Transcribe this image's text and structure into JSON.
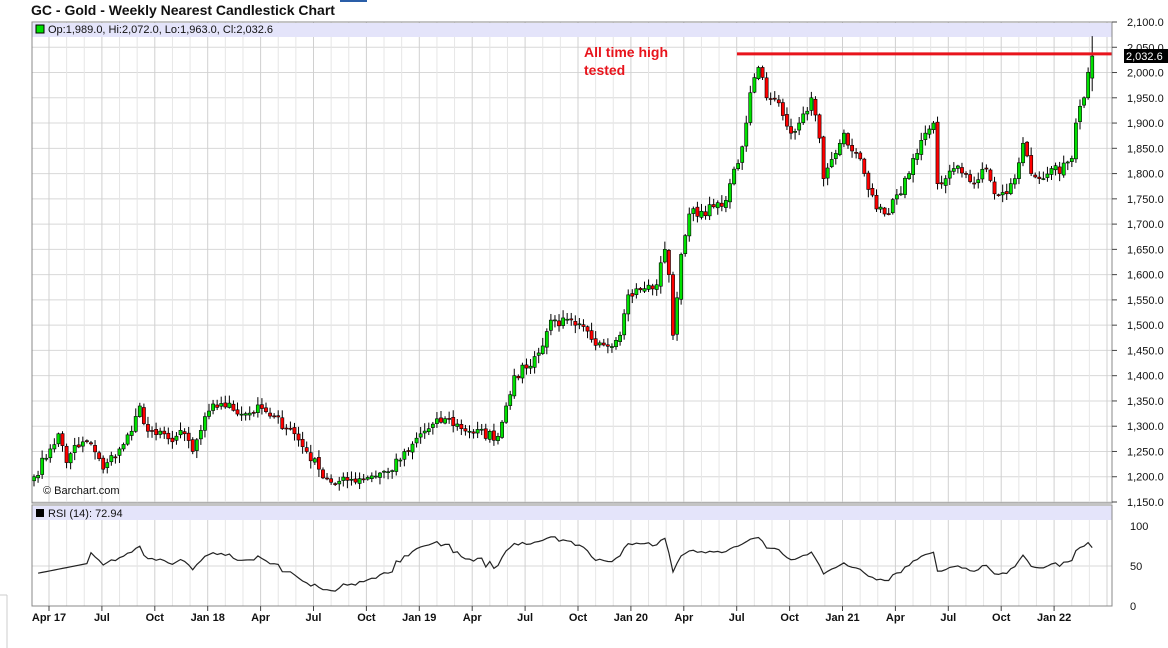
{
  "title": "GC - Gold - Weekly Nearest Candlestick Chart",
  "ohlc_label": "Op:1,989.0, Hi:2,072.0, Lo:1,963.0, Cl:2,032.6",
  "last_price_label": "2,032.6",
  "watermark": "© Barchart.com",
  "rsi_label": "RSI (14): 72.94",
  "annotation": [
    "All time high",
    "tested"
  ],
  "colors": {
    "up": "#00e000",
    "down": "#ff0000",
    "resistance": "#e8141c",
    "band": "#e4e4fa",
    "grid": "#d8d8d8"
  },
  "chart_data": {
    "type": "candlestick",
    "title": "GC - Gold - Weekly Nearest Candlestick Chart",
    "ylim": [
      1150,
      2100
    ],
    "y_ticks": [
      "2,100.0",
      "2,050.0",
      "2,000.0",
      "1,950.0",
      "1,900.0",
      "1,850.0",
      "1,800.0",
      "1,750.0",
      "1,700.0",
      "1,650.0",
      "1,600.0",
      "1,550.0",
      "1,500.0",
      "1,450.0",
      "1,400.0",
      "1,350.0",
      "1,300.0",
      "1,250.0",
      "1,200.0",
      "1,150.0"
    ],
    "x_ticks": [
      "Apr 17",
      "Jul",
      "Oct",
      "Jan 18",
      "Apr",
      "Jul",
      "Oct",
      "Jan 19",
      "Apr",
      "Jul",
      "Oct",
      "Jan 20",
      "Apr",
      "Jul",
      "Oct",
      "Jan 21",
      "Apr",
      "Jul",
      "Oct",
      "Jan 22"
    ],
    "resistance_level": 2037,
    "last_candle": {
      "open": 1989.0,
      "high": 2072.0,
      "low": 1963.0,
      "close": 2032.6
    },
    "weekly_close_keypoints": [
      [
        0,
        1200
      ],
      [
        4,
        1255
      ],
      [
        6,
        1285
      ],
      [
        8,
        1228
      ],
      [
        10,
        1262
      ],
      [
        14,
        1265
      ],
      [
        17,
        1215
      ],
      [
        21,
        1255
      ],
      [
        24,
        1290
      ],
      [
        26,
        1340
      ],
      [
        28,
        1290
      ],
      [
        33,
        1275
      ],
      [
        37,
        1285
      ],
      [
        39,
        1250
      ],
      [
        43,
        1330
      ],
      [
        46,
        1345
      ],
      [
        52,
        1325
      ],
      [
        56,
        1335
      ],
      [
        58,
        1320
      ],
      [
        63,
        1295
      ],
      [
        67,
        1250
      ],
      [
        70,
        1215
      ],
      [
        74,
        1185
      ],
      [
        78,
        1195
      ],
      [
        87,
        1210
      ],
      [
        92,
        1250
      ],
      [
        95,
        1285
      ],
      [
        101,
        1315
      ],
      [
        107,
        1290
      ],
      [
        114,
        1280
      ],
      [
        116,
        1340
      ],
      [
        118,
        1400
      ],
      [
        121,
        1415
      ],
      [
        124,
        1445
      ],
      [
        127,
        1510
      ],
      [
        133,
        1500
      ],
      [
        139,
        1465
      ],
      [
        143,
        1470
      ],
      [
        144,
        1480
      ],
      [
        146,
        1560
      ],
      [
        149,
        1570
      ],
      [
        153,
        1580
      ],
      [
        155,
        1650
      ],
      [
        156,
        1600
      ],
      [
        157,
        1480
      ],
      [
        159,
        1640
      ],
      [
        161,
        1720
      ],
      [
        169,
        1735
      ],
      [
        171,
        1780
      ],
      [
        173,
        1820
      ],
      [
        175,
        1900
      ],
      [
        176,
        1960
      ],
      [
        177,
        1990
      ],
      [
        178,
        2010
      ],
      [
        180,
        1950
      ],
      [
        183,
        1940
      ],
      [
        186,
        1880
      ],
      [
        188,
        1900
      ],
      [
        191,
        1950
      ],
      [
        193,
        1870
      ],
      [
        194,
        1790
      ],
      [
        197,
        1840
      ],
      [
        199,
        1880
      ],
      [
        202,
        1840
      ],
      [
        204,
        1800
      ],
      [
        207,
        1730
      ],
      [
        209,
        1720
      ],
      [
        213,
        1760
      ],
      [
        215,
        1800
      ],
      [
        217,
        1840
      ],
      [
        219,
        1880
      ],
      [
        221,
        1900
      ],
      [
        222,
        1780
      ],
      [
        224,
        1790
      ],
      [
        226,
        1810
      ],
      [
        229,
        1800
      ],
      [
        231,
        1780
      ],
      [
        234,
        1810
      ],
      [
        236,
        1760
      ],
      [
        239,
        1760
      ],
      [
        241,
        1790
      ],
      [
        243,
        1860
      ],
      [
        245,
        1800
      ],
      [
        247,
        1790
      ],
      [
        250,
        1810
      ],
      [
        252,
        1800
      ],
      [
        255,
        1830
      ],
      [
        256,
        1900
      ],
      [
        258,
        1950
      ],
      [
        260,
        2032.6
      ]
    ],
    "rsi": {
      "period": 14,
      "last": 72.94,
      "ylim": [
        0,
        100
      ],
      "y_ticks": [
        "100",
        "50",
        "0"
      ]
    }
  }
}
